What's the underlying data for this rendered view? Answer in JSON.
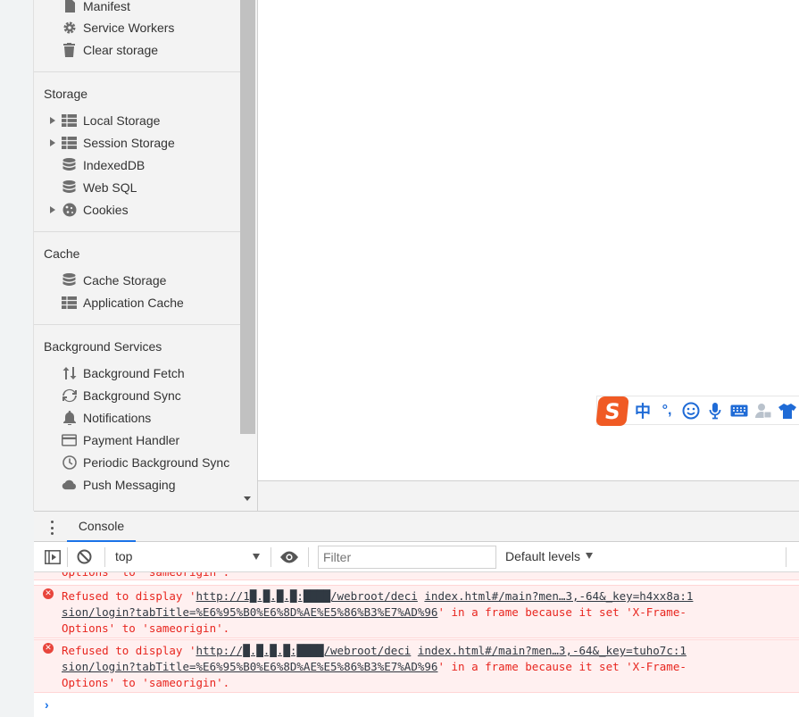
{
  "sidebar": {
    "top_items": [
      {
        "label": "Manifest",
        "icon": "file-icon"
      },
      {
        "label": "Service Workers",
        "icon": "gear-icon"
      },
      {
        "label": "Clear storage",
        "icon": "trash-icon"
      }
    ],
    "storage": {
      "title": "Storage",
      "items": [
        {
          "label": "Local Storage",
          "icon": "grid-icon",
          "expandable": true
        },
        {
          "label": "Session Storage",
          "icon": "grid-icon",
          "expandable": true
        },
        {
          "label": "IndexedDB",
          "icon": "database-icon",
          "expandable": false
        },
        {
          "label": "Web SQL",
          "icon": "database-icon",
          "expandable": false
        },
        {
          "label": "Cookies",
          "icon": "cookie-icon",
          "expandable": true
        }
      ]
    },
    "cache": {
      "title": "Cache",
      "items": [
        {
          "label": "Cache Storage",
          "icon": "database-icon"
        },
        {
          "label": "Application Cache",
          "icon": "grid-icon"
        }
      ]
    },
    "background": {
      "title": "Background Services",
      "items": [
        {
          "label": "Background Fetch",
          "icon": "up-down-arrows-icon"
        },
        {
          "label": "Background Sync",
          "icon": "sync-icon"
        },
        {
          "label": "Notifications",
          "icon": "bell-icon"
        },
        {
          "label": "Payment Handler",
          "icon": "credit-card-icon"
        },
        {
          "label": "Periodic Background Sync",
          "icon": "clock-icon"
        },
        {
          "label": "Push Messaging",
          "icon": "cloud-icon"
        }
      ]
    }
  },
  "ime": {
    "logo": "S",
    "lang": "中",
    "punct": "°,"
  },
  "drawer": {
    "tab_label": "Console",
    "context": "top",
    "filter_placeholder": "Filter",
    "levels_label": "Default levels"
  },
  "console": {
    "partial_line": "Options' to 'sameorigin'.",
    "messages": [
      {
        "line1_pre": "Refused to display '",
        "url1": "http://1█.█.█.█:████/webroot/deci",
        "line1_mid": " ",
        "url1b": "index.html#/main?men…3,-64&_key=h4xx8a:1",
        "line2_url": "sion/login?tabTitle=%E6%95%B0%E6%8D%AE%E5%86%B3%E7%AD%96",
        "line2_post": "' in a frame because it set 'X-Frame-",
        "line3": "Options' to 'sameorigin'."
      },
      {
        "line1_pre": "Refused to display '",
        "url1": "http://█.█.█.█:████/webroot/deci",
        "line1_mid": " ",
        "url1b": "index.html#/main?men…3,-64&_key=tuho7c:1",
        "line2_url": "sion/login?tabTitle=%E6%95%B0%E6%8D%AE%E5%86%B3%E7%AD%96",
        "line2_post": "' in a frame because it set 'X-Frame-",
        "line3": "Options' to 'sameorigin'."
      }
    ],
    "prompt": "›"
  }
}
